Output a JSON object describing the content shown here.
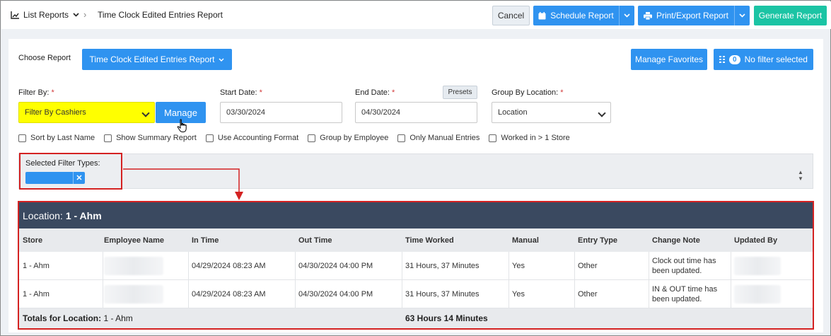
{
  "topbar": {
    "list_reports": "List Reports",
    "breadcrumb_current": "Time Clock Edited Entries Report",
    "cancel": "Cancel",
    "schedule": "Schedule Report",
    "print_export": "Print/Export Report",
    "generate": "Generate Report"
  },
  "panel": {
    "choose_label": "Choose Report",
    "report_select": "Time Clock Edited Entries Report",
    "manage_favorites": "Manage Favorites",
    "filter_count": "0",
    "filter_status": "No filter selected"
  },
  "form": {
    "filter_by_label": "Filter By:",
    "filter_by_value": "Filter By Cashiers",
    "manage": "Manage",
    "start_label": "Start Date:",
    "start_value": "03/30/2024",
    "end_label": "End Date:",
    "end_value": "04/30/2024",
    "presets": "Presets",
    "group_label": "Group By Location:",
    "group_value": "Location",
    "required_mark": "*",
    "checkboxes": [
      "Sort by Last Name",
      "Show Summary Report",
      "Use Accounting Format",
      "Group by Employee",
      "Only Manual Entries",
      "Worked in > 1 Store"
    ],
    "selected_filter_label": "Selected Filter Types:"
  },
  "report": {
    "location_prefix": "Location:",
    "location_name": "1 - Ahm",
    "columns": [
      "Store",
      "Employee Name",
      "In Time",
      "Out Time",
      "Time Worked",
      "Manual",
      "Entry Type",
      "Change Note",
      "Updated By"
    ],
    "rows": [
      {
        "store": "1 - Ahm",
        "in": "04/29/2024 08:23 AM",
        "out": "04/30/2024 04:00 PM",
        "worked": "31 Hours, 37 Minutes",
        "manual": "Yes",
        "type": "Other",
        "note": "Clock out time has been updated."
      },
      {
        "store": "1 - Ahm",
        "in": "04/29/2024 08:23 AM",
        "out": "04/30/2024 04:00 PM",
        "worked": "31 Hours, 37 Minutes",
        "manual": "Yes",
        "type": "Other",
        "note": "IN & OUT time has been updated."
      }
    ],
    "totals_label": "Totals for Location:",
    "totals_location": "1 - Ahm",
    "totals_worked": "63 Hours 14 Minutes"
  }
}
